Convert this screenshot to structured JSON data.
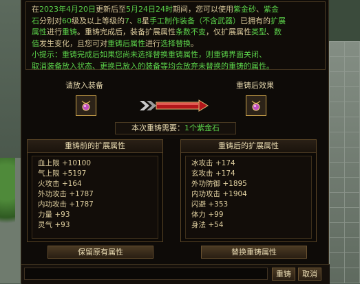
{
  "notice": {
    "line1_a": "在",
    "line1_date1": "2023年4月20日",
    "line1_b": "更新后至",
    "line1_date2": "5月24日24时",
    "line1_c": "期间，您可以使用",
    "line1_item1": "紫金砂",
    "line1_sep": "、",
    "line1_item2": "紫金",
    "line2_item2b": "石",
    "line2_a": "分别对",
    "line2_lv1": "60",
    "line2_b": "级及以上等级的",
    "line2_lv2": "7",
    "line2_sep": "、",
    "line2_lv3": "8",
    "line2_c": "星",
    "line2_d": "手工制作装备（不含武器）",
    "line2_e": "已拥有的",
    "line2_f": "扩展",
    "line3_f2": "属性",
    "line3_a": "进行",
    "line3_b": "重铸",
    "line3_c": "。重铸完成后，装备扩展属性",
    "line3_d": "条数不变",
    "line3_e": "，仅扩展属性",
    "line3_f": "类型",
    "line3_g": "、",
    "line3_h": "数",
    "line4_h2": "值",
    "line4_a": "发生变化，且您可对",
    "line4_b": "重铸后属性",
    "line4_c": "进行",
    "line4_d": "选择替换",
    "line4_e": "。",
    "tip_line1": "小提示：重铸完成后如果您尚未选择替换重铸属性，则重铸界面关闭、",
    "tip_line2": "取消装备放入状态、更换已放入的装备等均会放弃未替换的重铸的属性。"
  },
  "left_slot_label": "请放入装备",
  "right_slot_label": "重铸后效果",
  "left_slot_icon": "amethyst-necklace-icon",
  "right_slot_icon": "amethyst-necklace-icon",
  "cost": {
    "prefix": "本次重铸需要：",
    "amount": "1个紫金石"
  },
  "before": {
    "title": "重铸前的扩展属性",
    "stats": [
      "血上限 +10100",
      "气上限 +5197",
      "火攻击 +164",
      "外功攻击 +1787",
      "内功攻击 +1787",
      "力量 +93",
      "灵气 +93"
    ]
  },
  "after": {
    "title": "重铸后的扩展属性",
    "stats": [
      "冰攻击 +174",
      "玄攻击 +174",
      "外功防御 +1895",
      "内功攻击 +1904",
      "闪避 +353",
      "体力 +99",
      "身法 +54"
    ]
  },
  "buttons": {
    "keep": "保留原有属性",
    "replace": "替换重铸属性",
    "recast": "重铸",
    "cancel": "取消"
  },
  "colors": {
    "green": "#5bd14a",
    "orange": "#ff9a3a",
    "blue": "#55c8ff",
    "gold": "#c9a14a"
  }
}
